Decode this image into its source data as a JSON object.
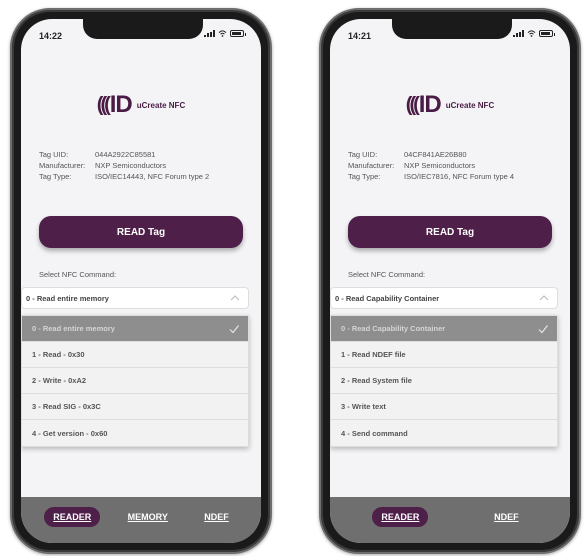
{
  "colors": {
    "brand_purple": "#4e1f48",
    "nav_gray": "#6f6f6f",
    "selected_item": "#8e8e8e"
  },
  "phones": [
    {
      "status_time": "14:22",
      "logo_text": "uCreate NFC",
      "tag_uid_label": "Tag UID:",
      "tag_uid_value": "044A2922C85581",
      "manufacturer_label": "Manufacturer:",
      "manufacturer_value": "NXP Semiconductors",
      "tag_type_label": "Tag Type:",
      "tag_type_value": "ISO/IEC14443, NFC Forum type 2",
      "read_button": "READ Tag",
      "select_label": "Select NFC Command:",
      "selected_command": "0 - Read entire memory",
      "commands": [
        "0 - Read entire memory",
        "1 - Read - 0x30",
        "2 - Write - 0xA2",
        "3 - Read SIG - 0x3C",
        "4 - Get version - 0x60"
      ],
      "nav": [
        "READER",
        "MEMORY",
        "NDEF"
      ],
      "active_nav": "READER"
    },
    {
      "status_time": "14:21",
      "logo_text": "uCreate NFC",
      "tag_uid_label": "Tag UID:",
      "tag_uid_value": "04CF841AE26B80",
      "manufacturer_label": "Manufacturer:",
      "manufacturer_value": "NXP Semiconductors",
      "tag_type_label": "Tag Type:",
      "tag_type_value": "ISO/IEC7816, NFC Forum type 4",
      "read_button": "READ Tag",
      "select_label": "Select NFC Command:",
      "selected_command": "0 - Read Capability Container",
      "commands": [
        "0 - Read Capability Container",
        "1 - Read NDEF file",
        "2 - Read System file",
        "3 - Write text",
        "4 - Send command"
      ],
      "nav": [
        "READER",
        "NDEF"
      ],
      "active_nav": "READER"
    }
  ]
}
